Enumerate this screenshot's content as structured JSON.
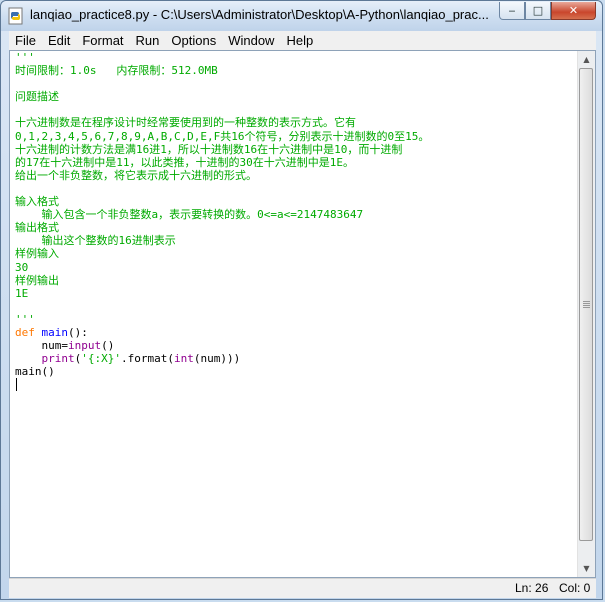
{
  "window": {
    "title": "lanqiao_practice8.py - C:\\Users\\Administrator\\Desktop\\A-Python\\lanqiao_prac...",
    "controls": {
      "minimize": "‒",
      "maximize": "□",
      "close": "✕"
    }
  },
  "menu": {
    "file": "File",
    "edit": "Edit",
    "format": "Format",
    "run": "Run",
    "options": "Options",
    "window": "Window",
    "help": "Help"
  },
  "editor": {
    "docstring_lines": [
      "'''",
      "时间限制：1.0s   内存限制：512.0MB",
      "",
      "问题描述",
      "",
      "十六进制数是在程序设计时经常要使用到的一种整数的表示方式。它有",
      "0,1,2,3,4,5,6,7,8,9,A,B,C,D,E,F共16个符号，分别表示十进制数的0至15。",
      "十六进制的计数方法是满16进1，所以十进制数16在十六进制中是10，而十进制",
      "的17在十六进制中是11，以此类推，十进制的30在十六进制中是1E。",
      "给出一个非负整数，将它表示成十六进制的形式。",
      "",
      "输入格式",
      "    输入包含一个非负整数a，表示要转换的数。0<=a<=2147483647",
      "输出格式",
      "    输出这个整数的16进制表示",
      "样例输入",
      "30",
      "样例输出",
      "1E",
      "",
      "'''"
    ],
    "code": {
      "kw_def": "def",
      "func_name": "main",
      "def_rest": "():",
      "indent": "    ",
      "assign_lhs": "num=",
      "builtin_input": "input",
      "call_parens": "()",
      "builtin_print": "print",
      "print_open": "(",
      "format_str": "'{:X}'",
      "format_call": ".format(",
      "builtin_int": "int",
      "print_tail": "(num)))",
      "main_call": "main()"
    }
  },
  "status": {
    "line": "Ln: 26",
    "col": "Col: 0"
  },
  "scrollbar": {
    "up_arrow": "▲",
    "down_arrow": "▼"
  }
}
